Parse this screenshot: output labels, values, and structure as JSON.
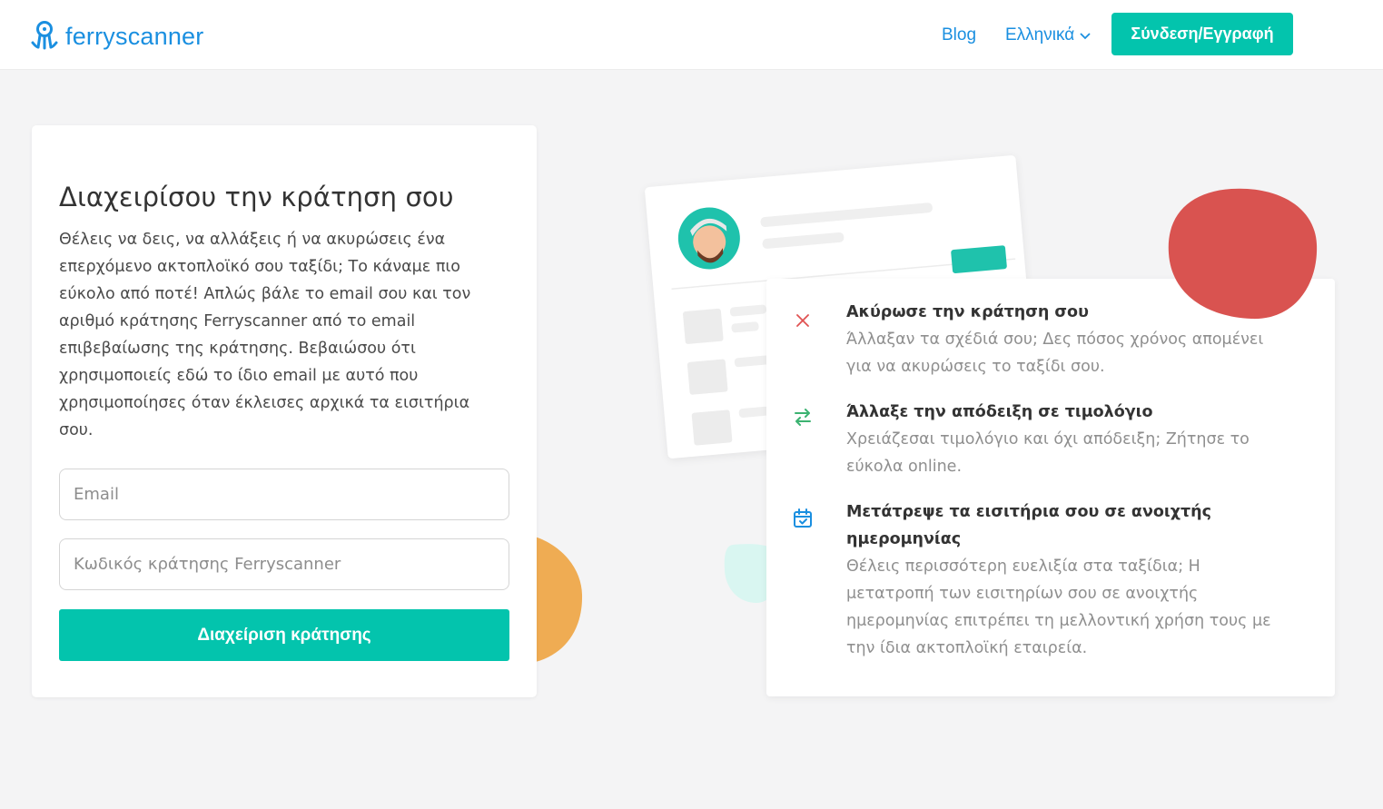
{
  "header": {
    "logo_text": "ferryscanner",
    "blog_label": "Blog",
    "language_label": "Ελληνικά",
    "login_label": "Σύνδεση/Εγγραφή"
  },
  "manage": {
    "title": "Διαχειρίσου την κράτηση σου",
    "description": "Θέλεις να δεις, να αλλάξεις ή να ακυρώσεις ένα επερχόμενο ακτοπλοϊκό σου ταξίδι; Το κάναμε πιο εύκολο από ποτέ! Απλώς βάλε το email σου και τον αριθμό κράτησης Ferryscanner από το email επιβεβαίωσης της κράτησης. Βεβαιώσου ότι χρησιμοποιείς εδώ το ίδιο email με αυτό που χρησιμοποίησες όταν έκλεισες αρχικά τα εισιτήρια σου.",
    "email_placeholder": "Email",
    "code_placeholder": "Κωδικός κράτησης Ferryscanner",
    "submit_label": "Διαχείριση κράτησης"
  },
  "features": [
    {
      "icon": "close-icon",
      "title": "Ακύρωσε την κράτηση σου",
      "text": "Άλλαξαν τα σχέδιά σου; Δες πόσος χρόνος απομένει για να ακυρώσεις το ταξίδι σου."
    },
    {
      "icon": "swap-arrows-icon",
      "title": "Άλλαξε την απόδειξη σε τιμολόγιο",
      "text": "Χρειάζεσαι τιμολόγιο και όχι απόδειξη; Ζήτησε το εύκολα online."
    },
    {
      "icon": "calendar-check-icon",
      "title": "Μετάτρεψε τα εισιτήρια σου σε ανοιχτής ημερομηνίας",
      "text": "Θέλεις περισσότερη ευελιξία στα ταξίδια; Η μετατροπή των εισιτηρίων σου σε ανοιχτής ημερομηνίας επιτρέπει τη μελλοντική χρήση τους με την ίδια ακτοπλοϊκή εταιρεία."
    }
  ],
  "colors": {
    "brand_blue": "#1a8fe0",
    "accent_teal": "#03c4ad",
    "blob_red": "#d95350",
    "blob_orange": "#efac53",
    "blob_mint": "#d9f6f1",
    "icon_red": "#e05252",
    "icon_green": "#3cb371",
    "icon_blue": "#1a8fe0"
  }
}
